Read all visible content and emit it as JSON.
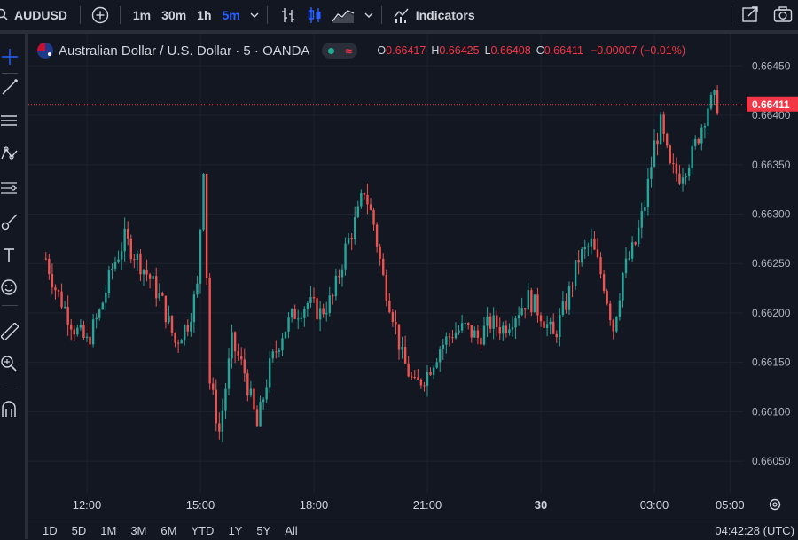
{
  "toolbar": {
    "symbol": "AUDUSD",
    "intervals": [
      "1m",
      "30m",
      "1h",
      "5m"
    ],
    "active_interval": "5m",
    "indicators_label": "Indicators",
    "icons": [
      "search-icon",
      "add-compare-icon",
      "chevron-down-icon",
      "bar-style-icon",
      "candle-style-icon",
      "area-style-icon",
      "indicators-icon",
      "snapshot-frame-icon",
      "camera-icon"
    ]
  },
  "left_tools": [
    "crosshair-icon",
    "trend-line-icon",
    "horizontal-lines-icon",
    "pattern-icon",
    "fib-icon",
    "brush-icon",
    "text-icon",
    "emoji-icon",
    "ruler-icon",
    "zoom-icon",
    "magnet-icon"
  ],
  "legend": {
    "title": "Australian Dollar / U.S. Dollar · 5 · OANDA",
    "approx_symbol": "≈",
    "o_key": "O",
    "o": "0.66417",
    "h_key": "H",
    "h": "0.66425",
    "l_key": "L",
    "l": "0.66408",
    "c_key": "C",
    "c": "0.66411",
    "change": "−0.00007 (−0.01%)"
  },
  "bottom": {
    "ranges": [
      "1D",
      "5D",
      "1M",
      "3M",
      "6M",
      "YTD",
      "1Y",
      "5Y",
      "All"
    ],
    "clock": "04:42:28 (UTC)"
  },
  "colors": {
    "up": "#26a69a",
    "down": "#ef5350",
    "background": "#131722",
    "grid": "#1e222d",
    "price_label": "#f23645"
  },
  "chart_data": {
    "type": "candlestick",
    "title": "Australian Dollar / U.S. Dollar · 5 · OANDA",
    "y_ticks": [
      "0.66450",
      "0.66400",
      "0.66350",
      "0.66300",
      "0.66250",
      "0.66200",
      "0.66150",
      "0.66100",
      "0.66050"
    ],
    "ylim": [
      0.66025,
      0.6647
    ],
    "x_ticks": [
      "12:00",
      "15:00",
      "18:00",
      "21:00",
      "30",
      "03:00",
      "05:00"
    ],
    "x_tick_times": [
      "12:00",
      "15:00",
      "18:00",
      "21:00",
      "00:00",
      "03:00",
      "05:00"
    ],
    "last_price": "0.66411",
    "series_close": [
      [
        "10:55",
        0.66255
      ],
      [
        "11:10",
        0.66225
      ],
      [
        "11:25",
        0.66205
      ],
      [
        "11:40",
        0.66185
      ],
      [
        "12:00",
        0.6617
      ],
      [
        "12:20",
        0.662
      ],
      [
        "12:40",
        0.66245
      ],
      [
        "13:00",
        0.66275
      ],
      [
        "13:20",
        0.66255
      ],
      [
        "13:40",
        0.66235
      ],
      [
        "14:00",
        0.6621
      ],
      [
        "14:20",
        0.6617
      ],
      [
        "14:40",
        0.6619
      ],
      [
        "14:55",
        0.66225
      ],
      [
        "15:05",
        0.6635
      ],
      [
        "15:15",
        0.6613
      ],
      [
        "15:30",
        0.6608
      ],
      [
        "15:50",
        0.6617
      ],
      [
        "16:10",
        0.6614
      ],
      [
        "16:30",
        0.66085
      ],
      [
        "16:50",
        0.66145
      ],
      [
        "17:10",
        0.6618
      ],
      [
        "17:30",
        0.662
      ],
      [
        "17:50",
        0.6621
      ],
      [
        "18:10",
        0.662
      ],
      [
        "18:30",
        0.66215
      ],
      [
        "18:50",
        0.66265
      ],
      [
        "19:10",
        0.663
      ],
      [
        "19:20",
        0.66325
      ],
      [
        "19:35",
        0.6629
      ],
      [
        "19:50",
        0.66235
      ],
      [
        "20:05",
        0.662
      ],
      [
        "20:20",
        0.66155
      ],
      [
        "20:40",
        0.66125
      ],
      [
        "21:00",
        0.6614
      ],
      [
        "21:20",
        0.66165
      ],
      [
        "21:40",
        0.6618
      ],
      [
        "22:00",
        0.66185
      ],
      [
        "22:20",
        0.66175
      ],
      [
        "22:40",
        0.6619
      ],
      [
        "23:00",
        0.66185
      ],
      [
        "23:20",
        0.662
      ],
      [
        "23:40",
        0.66215
      ],
      [
        "00:00",
        0.662
      ],
      [
        "00:20",
        0.66175
      ],
      [
        "00:40",
        0.6621
      ],
      [
        "01:00",
        0.66255
      ],
      [
        "01:20",
        0.6627
      ],
      [
        "01:40",
        0.6623
      ],
      [
        "01:55",
        0.66185
      ],
      [
        "02:10",
        0.6624
      ],
      [
        "02:30",
        0.6627
      ],
      [
        "02:45",
        0.6631
      ],
      [
        "03:00",
        0.6637
      ],
      [
        "03:10",
        0.6639
      ],
      [
        "03:25",
        0.66345
      ],
      [
        "03:40",
        0.6634
      ],
      [
        "04:00",
        0.6636
      ],
      [
        "04:15",
        0.6639
      ],
      [
        "04:25",
        0.6641
      ],
      [
        "04:35",
        0.66415
      ],
      [
        "04:40",
        0.66411
      ]
    ]
  }
}
